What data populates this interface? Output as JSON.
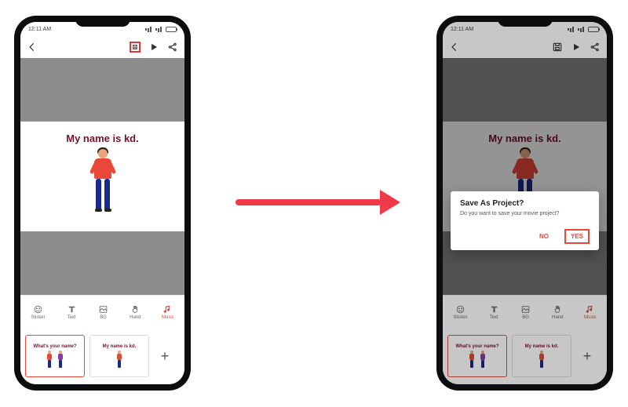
{
  "status": {
    "time": "12:11 AM",
    "carrier_icons": "signal wifi battery"
  },
  "appbar": {
    "back": "back",
    "actions": {
      "save": "save-icon",
      "play": "play-icon",
      "share": "share-icon"
    }
  },
  "slide": {
    "title": "My name is kd."
  },
  "toolbar": {
    "items": [
      {
        "label": "Sticker",
        "icon": "smile-icon"
      },
      {
        "label": "Text",
        "icon": "text-icon"
      },
      {
        "label": "BG",
        "icon": "bg-icon"
      },
      {
        "label": "Hand",
        "icon": "hand-icon"
      },
      {
        "label": "Music",
        "icon": "music-icon"
      }
    ],
    "active_index": 4
  },
  "timeline": {
    "clips": [
      {
        "title": "What's your name?"
      },
      {
        "title": "My name is kd."
      }
    ],
    "add_label": "+"
  },
  "dialog": {
    "title": "Save As Project?",
    "message": "Do you want to save your movie project?",
    "no": "NO",
    "yes": "YES"
  }
}
